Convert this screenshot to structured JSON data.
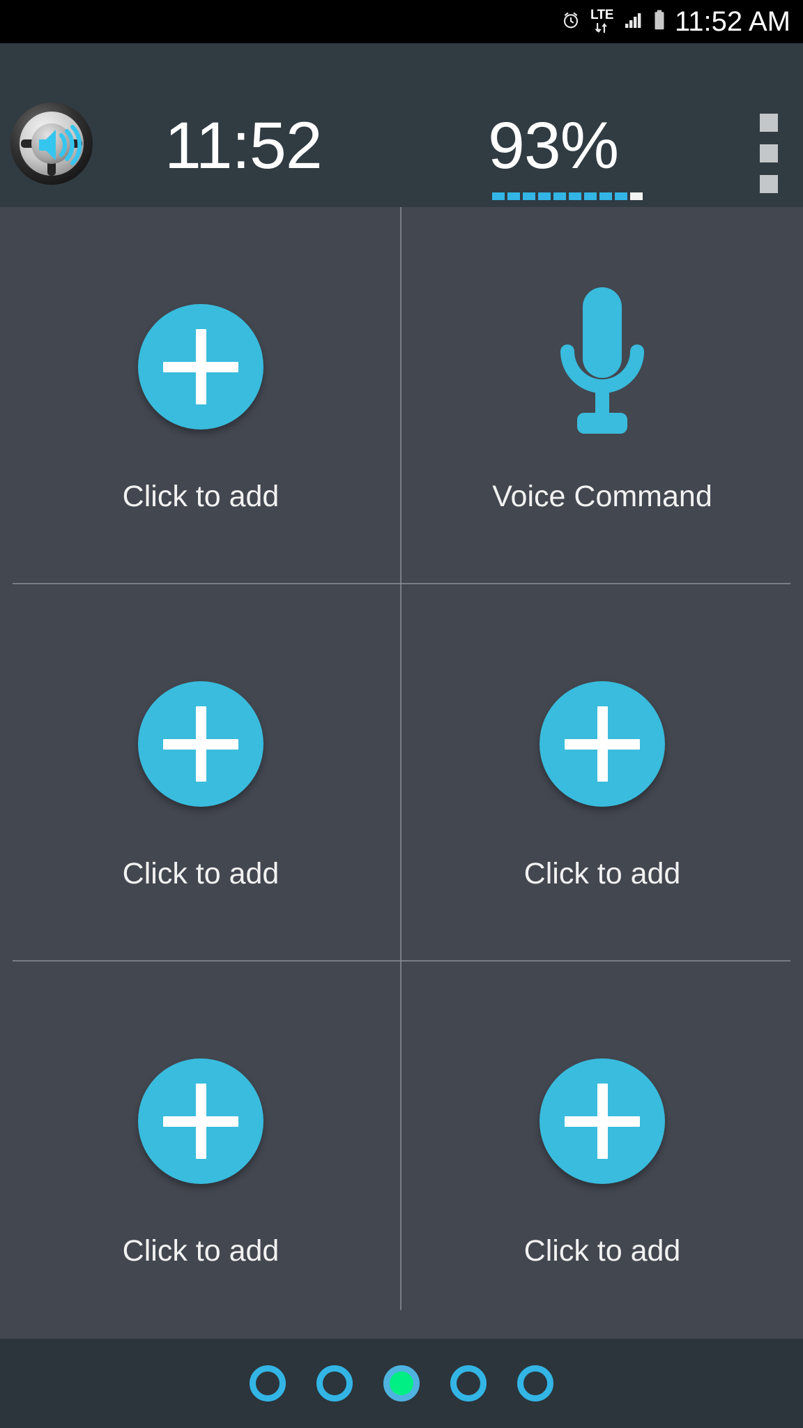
{
  "status_bar": {
    "clock": "11:52 AM",
    "network_label": "LTE",
    "icons": [
      "alarm-clock-icon",
      "lte-data-icon",
      "signal-bars-icon",
      "battery-icon"
    ]
  },
  "header": {
    "app_icon": "steering-wheel-speaker-icon",
    "time": "11:52",
    "battery_percent": "93%",
    "battery_segments_total": 10,
    "battery_segments_filled": 9,
    "overflow_menu": "overflow-menu-icon"
  },
  "grid": {
    "rows": [
      {
        "cells": [
          {
            "icon": "plus-icon",
            "label": "Click to add"
          },
          {
            "icon": "microphone-icon",
            "label": "Voice Command"
          }
        ]
      },
      {
        "cells": [
          {
            "icon": "plus-icon",
            "label": "Click to add"
          },
          {
            "icon": "plus-icon",
            "label": "Click to add"
          }
        ]
      },
      {
        "cells": [
          {
            "icon": "plus-icon",
            "label": "Click to add"
          },
          {
            "icon": "plus-icon",
            "label": "Click to add"
          }
        ]
      }
    ]
  },
  "pager": {
    "total_pages": 5,
    "active_page": 3
  },
  "colors": {
    "accent_cyan": "#33b5e5",
    "tile_cyan": "#39bcdd",
    "active_page_green": "#00ef84",
    "header_bg": "#303b42",
    "grid_bg": "#434750",
    "bottom_bar_bg": "#2b353b",
    "status_bar_bg": "#000000",
    "text_white": "#ffffff"
  }
}
